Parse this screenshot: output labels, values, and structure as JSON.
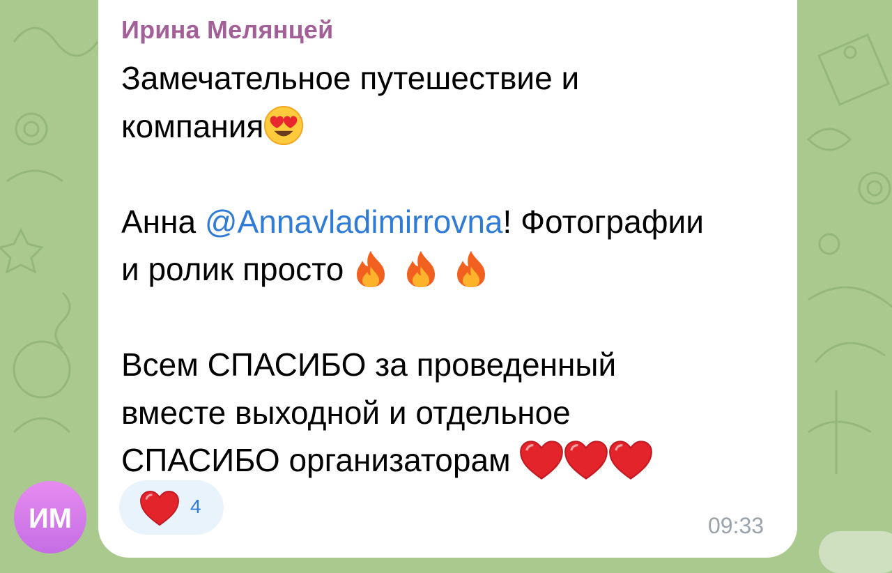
{
  "message": {
    "sender": "Ирина Мелянцей",
    "lines": {
      "l1": "Замечательное путешествие и",
      "l2": "компания",
      "l3a": "Анна ",
      "mention": "@Annavladimirrovna",
      "l3b": "!  Фотографии",
      "l4": "и ролик просто ",
      "l5": "Всем СПАСИБО за проведенный",
      "l6": "вместе выходной  и отдельное",
      "l7": "СПАСИБО организаторам "
    },
    "time": "09:33"
  },
  "reaction": {
    "icon": "heart-icon",
    "count": "4"
  },
  "avatar": {
    "initials": "ИМ"
  },
  "colors": {
    "background": "#a9c98f",
    "bubble": "#ffffff",
    "sender": "#a35f97",
    "link": "#2f7bd6",
    "avatar": "#d57ee9",
    "reaction_bg": "#e9f3fc"
  }
}
